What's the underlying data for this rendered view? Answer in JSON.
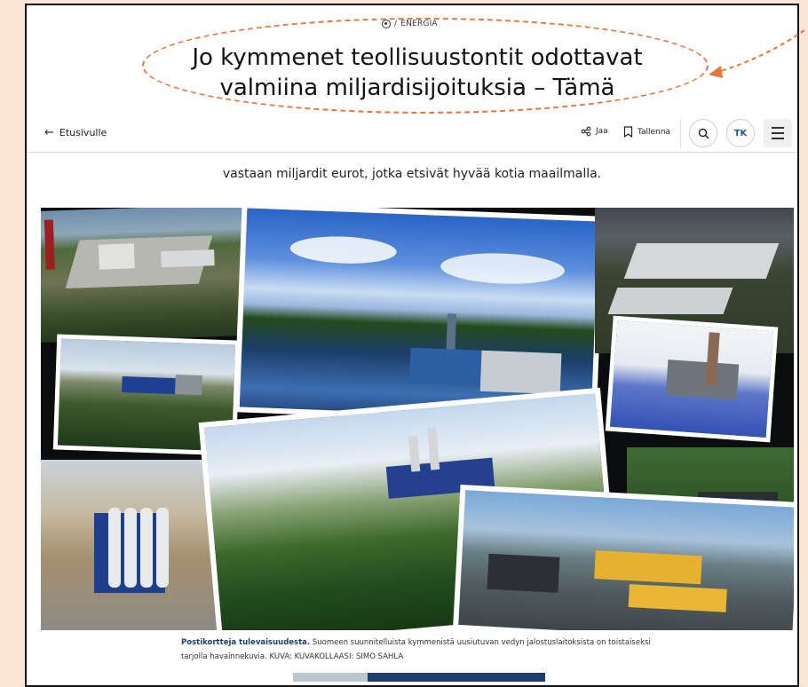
{
  "section": {
    "icon": "energy-badge-icon",
    "label": "ENERGIA"
  },
  "article": {
    "title_line1": "Jo kymmenet teollisuustontit odottavat",
    "title_line2": "valmiina miljardisijoituksia – Tämä",
    "lead": "vastaan miljardit eurot, jotka etsivät hyvää kotia maailmalla."
  },
  "toolbar": {
    "back_label": "Etusivulle",
    "share_label": "Jaa",
    "save_label": "Tallenna",
    "avatar_initials": "TK"
  },
  "caption": {
    "bold": "Postikortteja tulevaisuudesta.",
    "text": "Suomeen suunnitelluista kymmenistä uusiutuvan vedyn jalostuslaitoksista on toistaiseksi tarjolla havainnekuvia.",
    "credit": "KUVA: KUVAKOLLAASI: SIMO SAHLA"
  },
  "colors": {
    "annotation": "#e9743a",
    "background": "#fbe6d6",
    "brand": "#1e5a9c"
  }
}
